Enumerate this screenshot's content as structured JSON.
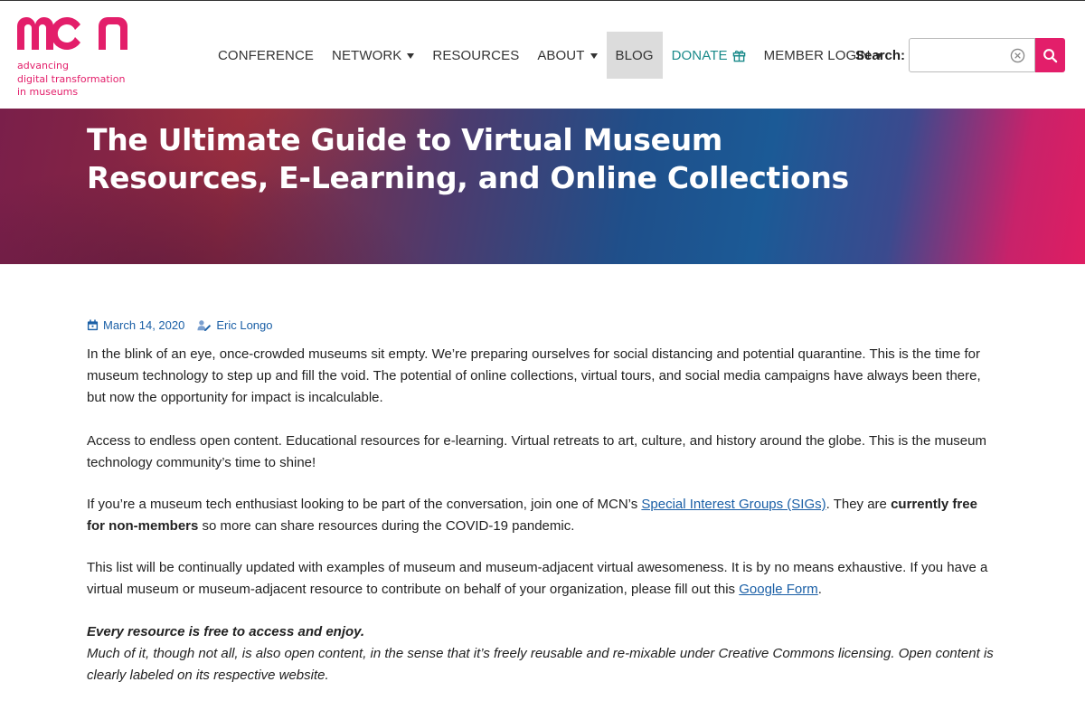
{
  "logo": {
    "text": "mcn",
    "tagline": [
      "advancing",
      "digital transformation",
      "in museums"
    ],
    "color": "#e31e6a"
  },
  "nav": {
    "items": [
      {
        "label": "CONFERENCE",
        "dropdown": false
      },
      {
        "label": "NETWORK",
        "dropdown": true
      },
      {
        "label": "RESOURCES",
        "dropdown": false
      },
      {
        "label": "ABOUT",
        "dropdown": true
      },
      {
        "label": "BLOG",
        "dropdown": false,
        "active": true
      },
      {
        "label": "DONATE",
        "dropdown": false,
        "icon": "gift-icon"
      },
      {
        "label": "MEMBER LOGIN",
        "dropdown": true
      }
    ]
  },
  "search": {
    "label": "Search:",
    "value": "",
    "placeholder": "",
    "clear_icon": "clear-icon",
    "button_icon": "search-icon"
  },
  "hero": {
    "title": "The Ultimate Guide to Virtual Museum Resources, E-Learning, and Online Collections"
  },
  "article": {
    "date": "March 14, 2020",
    "date_icon": "calendar-icon",
    "author": "Eric Longo",
    "author_icon": "author-icon",
    "p1": "In the blink of an eye, once-crowded museums sit empty. We’re preparing ourselves for social distancing and potential quarantine. This is the time for museum technology to step up and fill the void. The potential of online collections, virtual tours, and social media campaigns have always been there, but now the opportunity for impact is incalculable.",
    "p2": "Access to endless open content. Educational resources for e-learning. Virtual retreats to art, culture, and history around the globe. This is the museum technology community’s time to shine!",
    "p3": {
      "before": "If you’re a museum tech enthusiast looking to be part of the conversation, join one of MCN’s ",
      "link": "Special Interest Groups (SIGs)",
      "middle": ". They are ",
      "bold": "currently free for non-members",
      "after": " so more can share resources during the COVID-19 pandemic."
    },
    "p4": {
      "before": "This list will be continually updated with examples of museum and museum-adjacent virtual awesomeness. It is by no means exhaustive. If you have a virtual museum or museum-adjacent resource to contribute on behalf of your organization, please fill out this ",
      "link": "Google Form",
      "after": "."
    },
    "p5": {
      "bold": "Every resource is free to access and enjoy.",
      "text": "Much of it, though not all, is also open content, in the sense that it’s freely reusable and re-mixable under Creative Commons licensing. Open content is clearly labeled on its respective website."
    }
  },
  "colors": {
    "brand_pink": "#e31e6a",
    "link_blue": "#1a5fa6",
    "donate_teal": "#1a8a8a"
  }
}
